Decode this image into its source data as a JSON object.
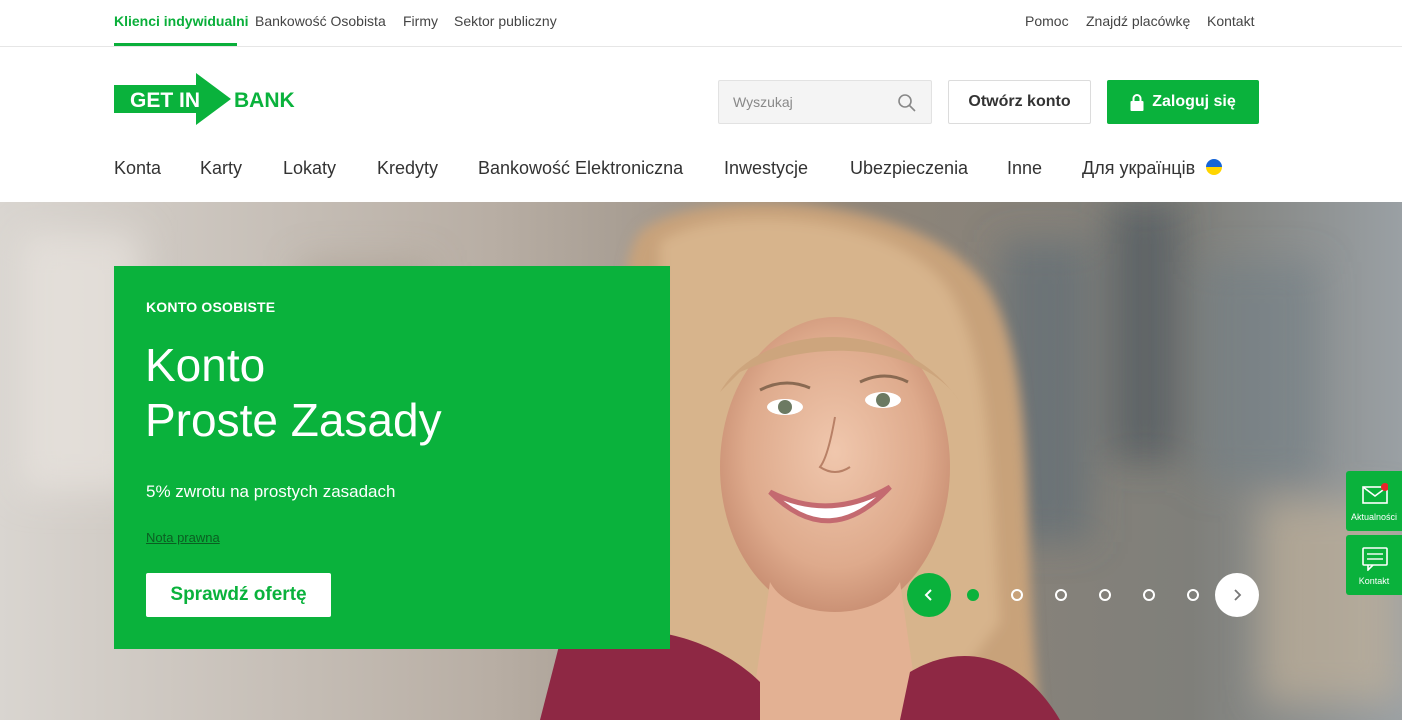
{
  "topbar": {
    "left": [
      "Klienci indywidualni",
      "Bankowość Osobista",
      "Firmy",
      "Sektor publiczny"
    ],
    "right": [
      "Pomoc",
      "Znajdź placówkę",
      "Kontakt"
    ]
  },
  "logo": {
    "text_left": "GET IN",
    "text_right": "BANK"
  },
  "search": {
    "placeholder": "Wyszukaj"
  },
  "buttons": {
    "open_account": "Otwórz konto",
    "login": "Zaloguj się"
  },
  "nav": [
    "Konta",
    "Karty",
    "Lokaty",
    "Kredyty",
    "Bankowość Elektroniczna",
    "Inwestycje",
    "Ubezpieczenia",
    "Inne",
    "Для українців"
  ],
  "promo": {
    "kicker": "KONTO OSOBISTE",
    "title_line1": "Konto",
    "title_line2": "Proste Zasady",
    "description": "5% zwrotu na prostych zasadach",
    "legal": "Nota prawna",
    "cta": "Sprawdź ofertę"
  },
  "carousel": {
    "slides": 6,
    "active": 1
  },
  "side": {
    "news": "Aktualności",
    "contact": "Kontakt"
  },
  "colors": {
    "brand": "#0ab23c",
    "text": "#333333"
  }
}
